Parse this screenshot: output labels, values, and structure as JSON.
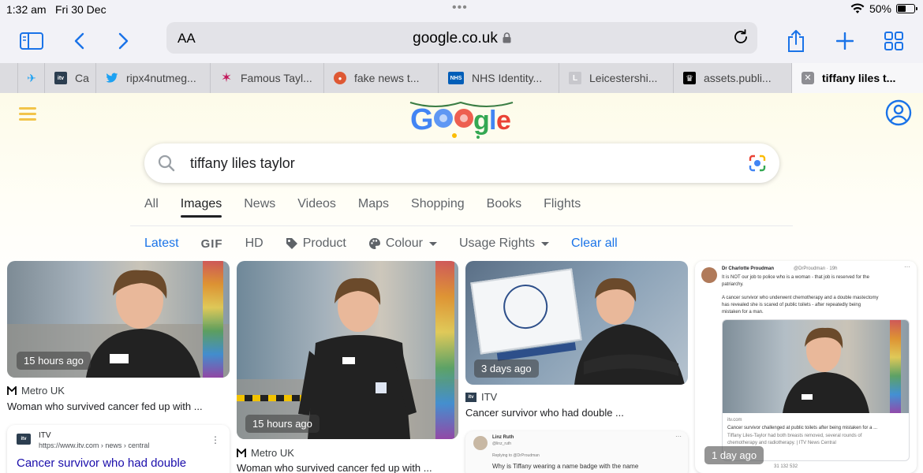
{
  "status": {
    "time": "1:32 am",
    "date": "Fri 30 Dec",
    "battery": "50%",
    "battery_level": 0.5
  },
  "toolbar": {
    "aa": "AA",
    "url": "google.co.uk"
  },
  "tabs": [
    {
      "label": "",
      "fav": "pin"
    },
    {
      "label": "Ca",
      "fav": "itv"
    },
    {
      "label": "ripx4nutmeg...",
      "fav": "twitter"
    },
    {
      "label": "Famous Tayl...",
      "fav": "star"
    },
    {
      "label": "fake news t...",
      "fav": "duck"
    },
    {
      "label": "NHS Identity...",
      "fav": "nhs"
    },
    {
      "label": "Leicestershi...",
      "fav": "L"
    },
    {
      "label": "assets.publi...",
      "fav": "crown"
    },
    {
      "label": "tiffany liles t...",
      "fav": "close",
      "active": true
    }
  ],
  "search": {
    "query": "tiffany liles taylor"
  },
  "nav": [
    "All",
    "Images",
    "News",
    "Videos",
    "Maps",
    "Shopping",
    "Books",
    "Flights"
  ],
  "filters": {
    "latest": "Latest",
    "gif": "GIF",
    "hd": "HD",
    "product": "Product",
    "colour": "Colour",
    "usage": "Usage Rights",
    "clear": "Clear all"
  },
  "results": [
    {
      "time": "15 hours ago",
      "source": "Metro UK",
      "title": "Woman who survived cancer fed up with ..."
    },
    {
      "time": "15 hours ago",
      "source": "Metro UK",
      "title": "Woman who survived cancer fed up with ..."
    },
    {
      "time": "3 days ago",
      "source": "ITV",
      "title": "Cancer survivor who had double ..."
    },
    {
      "time": "1 day ago"
    }
  ],
  "itv_snippet": {
    "site": "ITV",
    "url": "https://www.itv.com › news › central",
    "title": "Cancer survivor who had double"
  },
  "tweet": {
    "author": "Dr Charlotte Proudman",
    "handle": "@DrProudman · 19h",
    "line1": "It is NOT our job to police who is a woman - that job is reserved for the",
    "line2": "patriarchy.",
    "line3": "A cancer survivor who underwent chemotherapy and a double mastectomy",
    "line4": "has revealed she is scared of public toilets - after repeatedly being",
    "line5": "mistaken for a man.",
    "link_site": "itv.com",
    "link_title": "Cancer survivor challenged at public toilets after being mistaken for a ...",
    "link_desc1": "Tiffany Liles-Taylor had both breasts removed, several rounds of",
    "link_desc2": "chemotherapy and radiotherapy. | ITV News Central",
    "stats": "31    132    532"
  },
  "tweet2": {
    "author": "Linz Ruth",
    "handle": "@linz_ruth",
    "reply": "Replying to @DrProudman",
    "text": "Why is Tiffany wearing a name badge with the name"
  }
}
